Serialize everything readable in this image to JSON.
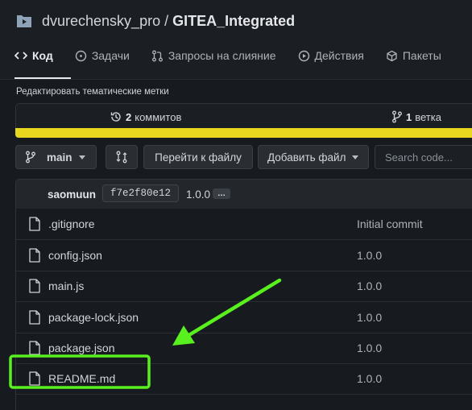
{
  "repo": {
    "owner": "dvurechensky_pro",
    "separator": "/",
    "name": "GITEA_Integrated",
    "icon": "repo-icon"
  },
  "tabs": [
    {
      "label": "Код",
      "icon": "code-icon",
      "active": true
    },
    {
      "label": "Задачи",
      "icon": "issue-icon"
    },
    {
      "label": "Запросы на слияние",
      "icon": "pull-request-icon"
    },
    {
      "label": "Действия",
      "icon": "play-icon"
    },
    {
      "label": "Пакеты",
      "icon": "package-icon"
    }
  ],
  "topics_link": "Редактировать тематические метки",
  "stats": {
    "commits_count": "2",
    "commits_label": "коммитов",
    "branches_count": "1",
    "branches_label": "ветка"
  },
  "language_bar_color": "#e8d61f",
  "toolbar": {
    "branch": "main",
    "go_to_file": "Перейти к файлу",
    "add_file": "Добавить файл",
    "search_placeholder": "Search code..."
  },
  "latest_commit": {
    "author": "saomuun",
    "sha": "f7e2f80e12",
    "message": "1.0.0",
    "ellipsis": "…"
  },
  "files": [
    {
      "name": ".gitignore",
      "message": "Initial commit"
    },
    {
      "name": "config.json",
      "message": "1.0.0"
    },
    {
      "name": "main.js",
      "message": "1.0.0"
    },
    {
      "name": "package-lock.json",
      "message": "1.0.0"
    },
    {
      "name": "package.json",
      "message": "1.0.0"
    },
    {
      "name": "README.md",
      "message": "1.0.0",
      "highlighted": true
    }
  ],
  "annotation_color": "#59f01f"
}
